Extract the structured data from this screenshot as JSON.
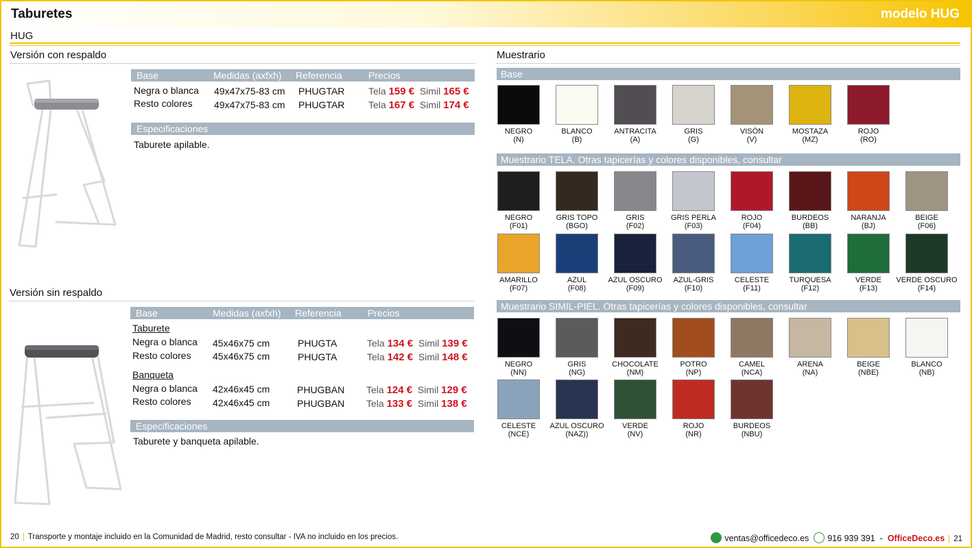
{
  "header": {
    "title": "Taburetes",
    "model": "modelo HUG"
  },
  "subtitle": "HUG",
  "colors": {
    "accent": "#f2c40a",
    "price_red": "#d0131f",
    "bar": "#a6b5c1"
  },
  "left": {
    "v1": {
      "title": "Versión con respaldo",
      "head": {
        "base": "Base",
        "medidas": "Medidas (axfxh)",
        "ref": "Referencia",
        "precios": "Precios"
      },
      "rows": [
        {
          "base": "Negra o blanca",
          "medidas": "49x47x75-83 cm",
          "ref": "PHUGTAR",
          "tela_label": "Tela",
          "tela": "159 €",
          "simil_label": "Simil",
          "simil": "165 €"
        },
        {
          "base": "Resto colores",
          "medidas": "49x47x75-83 cm",
          "ref": "PHUGTAR",
          "tela_label": "Tela",
          "tela": "167 €",
          "simil_label": "Simil",
          "simil": "174 €"
        }
      ],
      "spec_head": "Especificaciones",
      "spec": "Taburete apilable."
    },
    "v2": {
      "title": "Versión sin respaldo",
      "head": {
        "base": "Base",
        "medidas": "Medidas (axfxh)",
        "ref": "Referencia",
        "precios": "Precios"
      },
      "group1": "Taburete",
      "rows1": [
        {
          "base": "Negra o blanca",
          "medidas": "45x46x75 cm",
          "ref": "PHUGTA",
          "tela_label": "Tela",
          "tela": "134 €",
          "simil_label": "Simil",
          "simil": "139 €"
        },
        {
          "base": "Resto colores",
          "medidas": "45x46x75 cm",
          "ref": "PHUGTA",
          "tela_label": "Tela",
          "tela": "142 €",
          "simil_label": "Simil",
          "simil": "148 €"
        }
      ],
      "group2": "Banqueta",
      "rows2": [
        {
          "base": "Negra o blanca",
          "medidas": "42x46x45 cm",
          "ref": "PHUGBAN",
          "tela_label": "Tela",
          "tela": "124 €",
          "simil_label": "Simil",
          "simil": "129 €"
        },
        {
          "base": "Resto colores",
          "medidas": "42x46x45 cm",
          "ref": "PHUGBAN",
          "tela_label": "Tela",
          "tela": "133 €",
          "simil_label": "Simil",
          "simil": "138 €"
        }
      ],
      "spec_head": "Especificaciones",
      "spec": "Taburete y banqueta apilable."
    }
  },
  "muestrario": {
    "title": "Muestrario",
    "base": {
      "head": "Base",
      "items": [
        {
          "name": "NEGRO",
          "code": "(N)",
          "color": "#0b0b0d"
        },
        {
          "name": "BLANCO",
          "code": "(B)",
          "color": "#fbfbf2"
        },
        {
          "name": "ANTRACITA",
          "code": "(A)",
          "color": "#514d52"
        },
        {
          "name": "GRIS",
          "code": "(G)",
          "color": "#d7d4ce"
        },
        {
          "name": "VISÓN",
          "code": "(V)",
          "color": "#a49378"
        },
        {
          "name": "MOSTAZA",
          "code": "(MZ)",
          "color": "#ddb40f"
        },
        {
          "name": "ROJO",
          "code": "(RO)",
          "color": "#8c1a2c"
        }
      ]
    },
    "tela": {
      "head": "Muestrario TELA. Otras tapicerías y colores disponibles, consultar",
      "row1": [
        {
          "name": "NEGRO",
          "code": "(F01)",
          "color": "#1d1e1e"
        },
        {
          "name": "GRIS TOPO",
          "code": "(BGO)",
          "color": "#34291e"
        },
        {
          "name": "GRIS",
          "code": "(F02)",
          "color": "#86888b"
        },
        {
          "name": "GRIS PERLA",
          "code": "(F03)",
          "color": "#c4c6cf"
        },
        {
          "name": "ROJO",
          "code": "(F04)",
          "color": "#b0182a"
        },
        {
          "name": "BURDEOS",
          "code": "(BB)",
          "color": "#5a1719"
        },
        {
          "name": "NARANJA",
          "code": "(BJ)",
          "color": "#cf4718"
        },
        {
          "name": "BEIGE",
          "code": "(F06)",
          "color": "#a09484"
        }
      ],
      "row2": [
        {
          "name": "AMARILLO",
          "code": "(F07)",
          "color": "#e9a42a"
        },
        {
          "name": "AZUL",
          "code": "(F08)",
          "color": "#1a3f78"
        },
        {
          "name": "AZUL OSCURO",
          "code": "(F09)",
          "color": "#1a213a"
        },
        {
          "name": "AZUL-GRIS",
          "code": "(F10)",
          "color": "#4a5b80"
        },
        {
          "name": "CELESTE",
          "code": "(F11)",
          "color": "#6e9fd6"
        },
        {
          "name": "TURQUESA",
          "code": "(F12)",
          "color": "#1b6b72"
        },
        {
          "name": "VERDE",
          "code": "(F13)",
          "color": "#1e6d3a"
        },
        {
          "name": "VERDE OSCURO",
          "code": "(F14)",
          "color": "#1c3a27"
        }
      ]
    },
    "simil": {
      "head": "Muestrario SIMIL-PIEL. Otras tapicerías y colores disponibles, consultar",
      "row1": [
        {
          "name": "NEGRO",
          "code": "(NN)",
          "color": "#0d0f14"
        },
        {
          "name": "GRIS",
          "code": "(NG)",
          "color": "#5a5b5c"
        },
        {
          "name": "CHOCOLATE",
          "code": "(NM)",
          "color": "#3e2a20"
        },
        {
          "name": "POTRO",
          "code": "(NP)",
          "color": "#a24d1d"
        },
        {
          "name": "CAMEL",
          "code": "(NCA)",
          "color": "#8f7863"
        },
        {
          "name": "ARENA",
          "code": "(NA)",
          "color": "#c6b7a2"
        },
        {
          "name": "BEIGE",
          "code": "(NBE)",
          "color": "#d9c08a"
        },
        {
          "name": "BLANCO",
          "code": "(NB)",
          "color": "#f6f5f2"
        }
      ],
      "row2": [
        {
          "name": "CELESTE",
          "code": "(NCE)",
          "color": "#8aa3ba"
        },
        {
          "name": "AZUL OSCURO",
          "code": "(NAZ))",
          "color": "#283450"
        },
        {
          "name": "VERDE",
          "code": "(NV)",
          "color": "#2f5136"
        },
        {
          "name": "ROJO",
          "code": "(NR)",
          "color": "#bf2b22"
        },
        {
          "name": "BURDEOS",
          "code": "(NBU)",
          "color": "#6e3430"
        }
      ]
    }
  },
  "footer": {
    "page_left": "20",
    "note": "Transporte y montaje incluido en la Comunidad de Madrid, resto consultar - IVA no incluido en los precios.",
    "email": "ventas@officedeco.es",
    "phone": "916 939 391",
    "sep": "-",
    "brand": "OfficeDeco.es",
    "page_right": "21"
  }
}
